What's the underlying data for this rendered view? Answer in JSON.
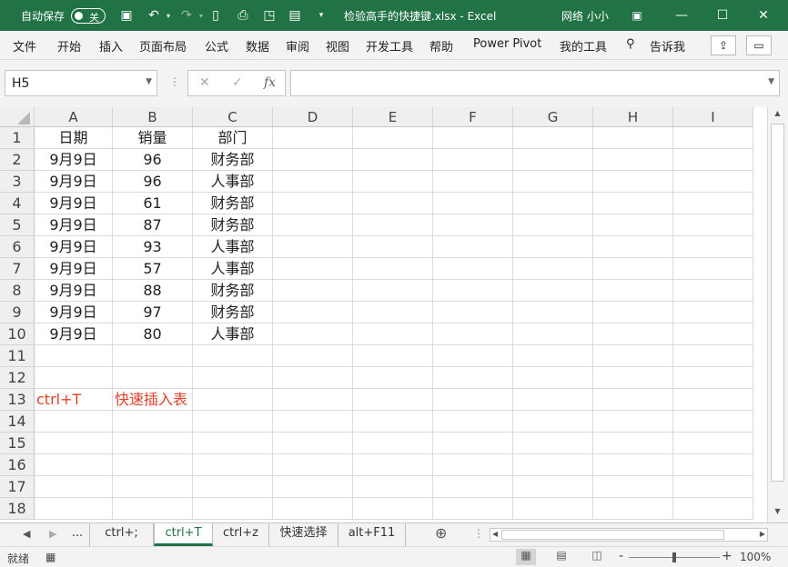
{
  "titlebar": {
    "autosave": "自动保存",
    "toggle": "关",
    "doc_title": "检验高手的快捷键.xlsx  -  Excel",
    "user": "网络 小小"
  },
  "menu": [
    "文件",
    "开始",
    "插入",
    "页面布局",
    "公式",
    "数据",
    "审阅",
    "视图",
    "开发工具",
    "帮助",
    "Power Pivot",
    "我的工具",
    "告诉我"
  ],
  "formula": {
    "namebox": "H5",
    "fx": "fx",
    "content": ""
  },
  "columns": [
    "A",
    "B",
    "C",
    "D",
    "E",
    "F",
    "G",
    "H",
    "I"
  ],
  "rows": [
    "1",
    "2",
    "3",
    "4",
    "5",
    "6",
    "7",
    "8",
    "9",
    "10",
    "11",
    "12",
    "13",
    "14",
    "15",
    "16",
    "17",
    "18"
  ],
  "cells": {
    "r1": [
      "日期",
      "销量",
      "部门"
    ],
    "r2": [
      "9月9日",
      "96",
      "财务部"
    ],
    "r3": [
      "9月9日",
      "96",
      "人事部"
    ],
    "r4": [
      "9月9日",
      "61",
      "财务部"
    ],
    "r5": [
      "9月9日",
      "87",
      "财务部"
    ],
    "r6": [
      "9月9日",
      "93",
      "人事部"
    ],
    "r7": [
      "9月9日",
      "57",
      "人事部"
    ],
    "r8": [
      "9月9日",
      "88",
      "财务部"
    ],
    "r9": [
      "9月9日",
      "97",
      "财务部"
    ],
    "r10": [
      "9月9日",
      "80",
      "人事部"
    ],
    "r13": [
      "ctrl+T",
      "快速插入表"
    ]
  },
  "note_color": "#e0402a",
  "accent": "#217346",
  "tabs": {
    "more": "...",
    "t1": "ctrl+;",
    "t2": "ctrl+T",
    "t3": "ctrl+z",
    "t4": "快速选择",
    "t5": "alt+F11",
    "add": "⊕"
  },
  "status": {
    "ready": "就绪",
    "zoom_minus": "-",
    "zoom_plus": "+",
    "zoom_level": "100%"
  }
}
